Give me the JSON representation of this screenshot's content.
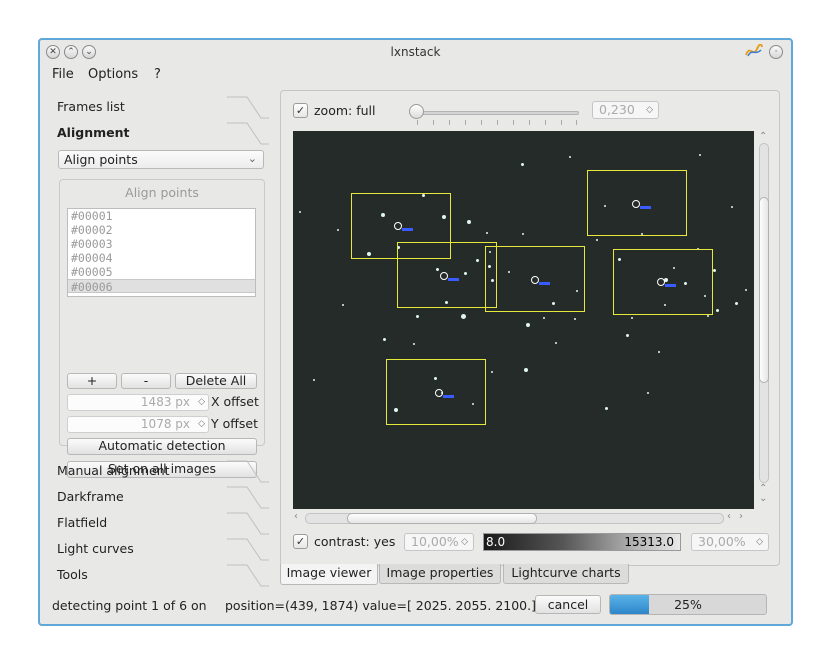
{
  "window": {
    "title": "lxnstack"
  },
  "menu": [
    "File",
    "Options",
    "?"
  ],
  "toolbox": {
    "tabs_top": [
      "Frames list",
      "Alignment"
    ],
    "tabs_bottom": [
      "Manual alignment",
      "Darkframe",
      "Flatfield",
      "Light curves",
      "Tools"
    ],
    "align_mode": "Align points",
    "group_title": "Align points",
    "points": [
      "#00001",
      "#00002",
      "#00003",
      "#00004",
      "#00005",
      "#00006"
    ],
    "selected_point": "#00006",
    "add_label": "+",
    "remove_label": "-",
    "delete_all_label": "Delete All",
    "x_offset": {
      "value": "1483 px",
      "label": "X offset"
    },
    "y_offset": {
      "value": "1078 px",
      "label": "Y offset"
    },
    "auto_detect_label": "Automatic detection",
    "set_all_label": "Set on all images"
  },
  "viewer": {
    "zoom_label": "zoom: full",
    "zoom_value": "0,230",
    "contrast_label": "contrast: yes",
    "contrast_min_pct": "10,00%",
    "contrast_max_pct": "30,00%",
    "level_min": "8.0",
    "level_max": "15313.0"
  },
  "tabs": [
    "Image viewer",
    "Image properties",
    "Lightcurve charts"
  ],
  "status": {
    "message": "detecting point 1 of 6 on",
    "position_text": "position=(439, 1874) value=[ 2025.  2055.  2100.]",
    "cancel_label": "cancel",
    "progress_text": "25%",
    "progress_fraction": 0.25
  },
  "colors": {
    "accent": "#5fa8d9",
    "progress": "#2e86c9",
    "box": "#e8e83a",
    "sky": "#252b29"
  }
}
